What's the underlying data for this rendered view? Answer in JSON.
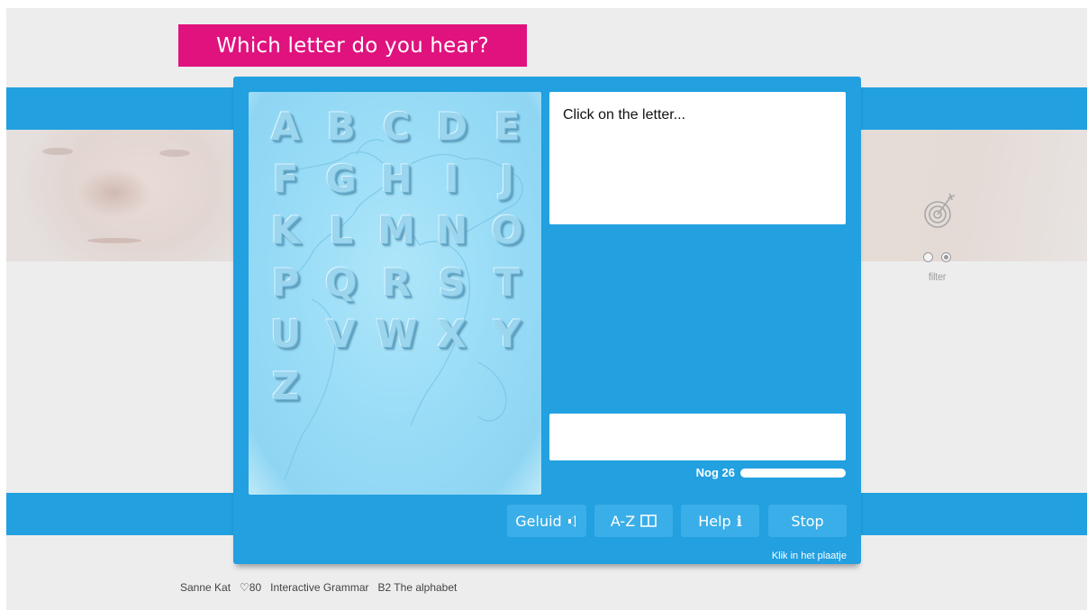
{
  "title": "Which letter do you hear?",
  "letters": [
    "A",
    "B",
    "C",
    "D",
    "E",
    "F",
    "G",
    "H",
    "I",
    "J",
    "K",
    "L",
    "M",
    "N",
    "O",
    "P",
    "Q",
    "R",
    "S",
    "T",
    "U",
    "V",
    "W",
    "X",
    "Y",
    "Z"
  ],
  "question": {
    "prompt": "Click on the letter...",
    "answer_value": ""
  },
  "progress": {
    "label": "Nog 26",
    "fraction": 1.0
  },
  "buttons": {
    "geluid": {
      "label": "Geluid",
      "icon": "speaker-icon"
    },
    "az": {
      "label": "A-Z",
      "icon": "book-icon"
    },
    "help": {
      "label": "Help",
      "icon": "info-icon",
      "icon_text": "i"
    },
    "stop": {
      "label": "Stop"
    }
  },
  "footer_link": "Klik in het plaatje",
  "side": {
    "filter_label": "filter",
    "icon": "target-icon",
    "radio_selected": 2
  },
  "status": {
    "user": "Sanne Kat",
    "score": "♡80",
    "course": "Interactive Grammar",
    "lesson": "B2 The alphabet"
  },
  "colors": {
    "accent": "#22a0e0",
    "title_bg": "#e0127e",
    "button_bg": "#3aaee8"
  }
}
